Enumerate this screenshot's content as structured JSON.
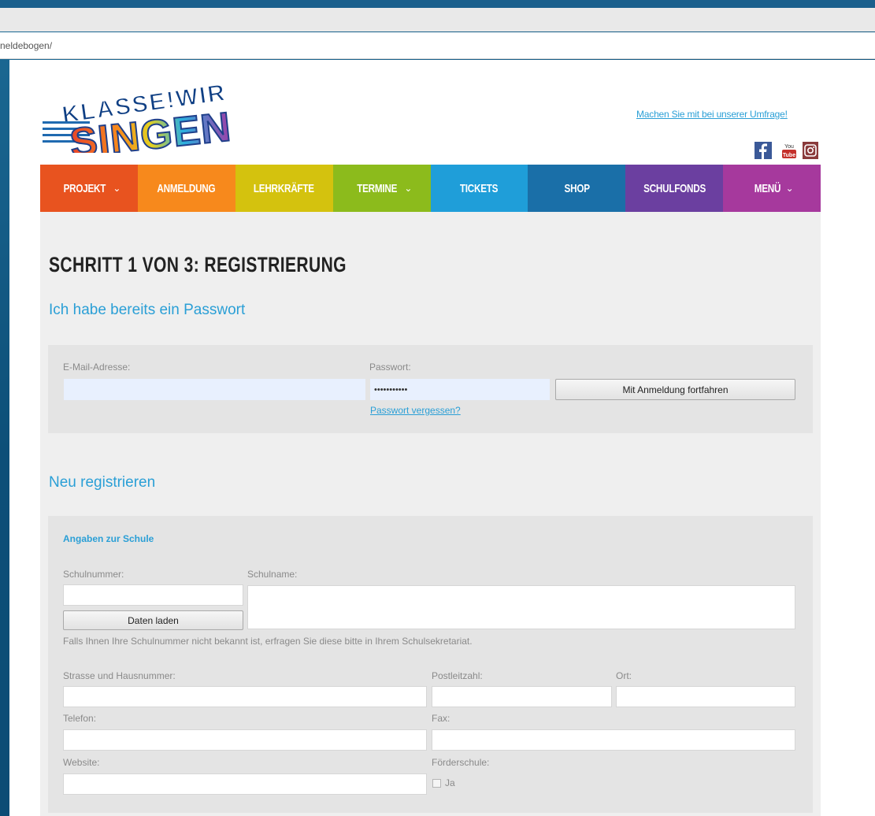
{
  "browser": {
    "url_fragment": "neldebogen/"
  },
  "header": {
    "logo_line1": "KLASSE!WIR",
    "logo_line2": "SINGEN",
    "survey_link": "Machen Sie mit bei unserer Umfrage!",
    "social_icons": [
      "facebook-icon",
      "youtube-icon",
      "instagram-icon"
    ],
    "youtube_text_top": "You",
    "youtube_text_bottom": "Tube"
  },
  "nav": {
    "items": [
      {
        "label": "PROJEKT",
        "has_dropdown": true,
        "color": "#e8531f"
      },
      {
        "label": "ANMELDUNG",
        "has_dropdown": false,
        "color": "#f7891c"
      },
      {
        "label": "LEHRKRÄFTE",
        "has_dropdown": false,
        "color": "#d4c20e"
      },
      {
        "label": "TERMINE",
        "has_dropdown": true,
        "color": "#8cbb1c"
      },
      {
        "label": "TICKETS",
        "has_dropdown": false,
        "color": "#1f9ed9"
      },
      {
        "label": "SHOP",
        "has_dropdown": false,
        "color": "#1a6fa8"
      },
      {
        "label": "SCHULFONDS",
        "has_dropdown": false,
        "color": "#6b3fa0"
      },
      {
        "label": "MENÜ",
        "has_dropdown": true,
        "color": "#a6399d"
      }
    ],
    "chevron": "⌄"
  },
  "main": {
    "step_title": "SCHRITT 1 VON 3: REGISTRIERUNG",
    "login": {
      "heading": "Ich habe bereits ein Passwort",
      "email_label": "E-Mail-Adresse:",
      "email_value": "",
      "password_label": "Passwort:",
      "password_value": "•••••••••••",
      "submit_label": "Mit Anmeldung fortfahren",
      "forgot_link": "Passwort vergessen?"
    },
    "register": {
      "heading": "Neu registrieren",
      "school_section": "Angaben zur Schule",
      "schulnummer_label": "Schulnummer:",
      "schulname_label": "Schulname:",
      "load_button": "Daten laden",
      "hint": "Falls Ihnen Ihre Schulnummer nicht bekannt ist, erfragen Sie diese bitte in Ihrem Schulsekretariat.",
      "strasse_label": "Strasse und Hausnummer:",
      "plz_label": "Postleitzahl:",
      "ort_label": "Ort:",
      "telefon_label": "Telefon:",
      "fax_label": "Fax:",
      "website_label": "Website:",
      "foerderschule_label": "Förderschule:",
      "foerderschule_option": "Ja"
    }
  },
  "colors": {
    "accent": "#2a9fd6",
    "content_bg": "#efefef",
    "box_bg": "#e4e4e4"
  }
}
